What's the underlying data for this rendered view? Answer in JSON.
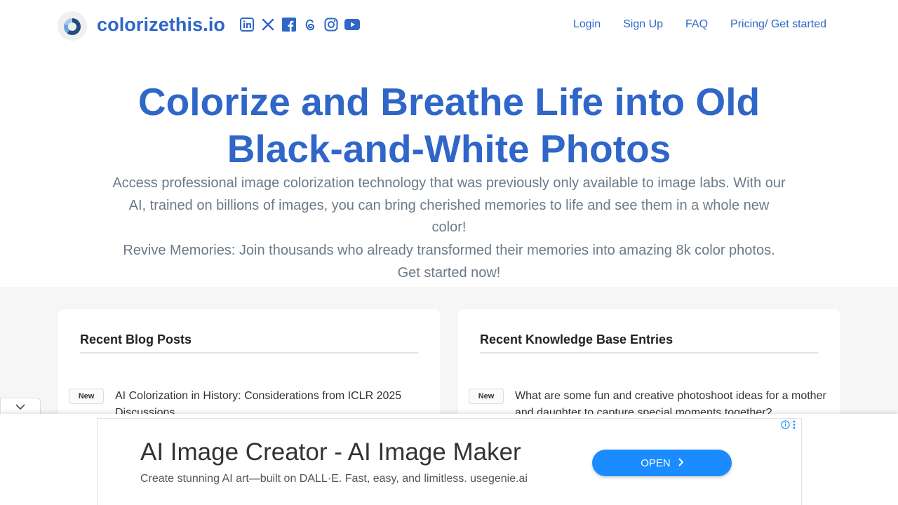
{
  "header": {
    "brand": "colorizethis.io",
    "logo_icon": "colorizethis-logo-icon",
    "socials": [
      {
        "icon": "linkedin-icon"
      },
      {
        "icon": "x-icon"
      },
      {
        "icon": "facebook-icon"
      },
      {
        "icon": "threads-icon"
      },
      {
        "icon": "instagram-icon"
      },
      {
        "icon": "youtube-icon"
      }
    ],
    "nav": [
      {
        "label": "Login"
      },
      {
        "label": "Sign Up"
      },
      {
        "label": "FAQ"
      },
      {
        "label": "Pricing/ Get started"
      }
    ]
  },
  "hero": {
    "title": "Colorize and Breathe Life into Old Black-and-White Photos",
    "subtitle": "Access professional image colorization technology that was previously only available to image labs. With our AI, trained on billions of images, you can bring cherished memories to life and see them in a whole new color!",
    "subtitle2": "Revive Memories: Join thousands who already transformed their memories into amazing 8k color photos. Get started now!"
  },
  "blog": {
    "heading": "Recent Blog Posts",
    "items": [
      {
        "badge": "New",
        "title": "AI Colorization in History: Considerations from ICLR 2025 Discussions"
      }
    ]
  },
  "kb": {
    "heading": "Recent Knowledge Base Entries",
    "items": [
      {
        "badge": "New",
        "title": "What are some fun and creative photoshoot ideas for a mother and daughter to capture special moments together?"
      }
    ]
  },
  "ad": {
    "title": "AI Image Creator - AI Image Maker",
    "description": "Create stunning AI art—built on DALL·E. Fast, easy, and limitless. usegenie.ai",
    "button": "OPEN"
  },
  "colors": {
    "brand": "#2f66c8",
    "text_muted": "#6b7a89",
    "ad_button": "#1a8cff",
    "section_bg": "#f6f6f6"
  }
}
